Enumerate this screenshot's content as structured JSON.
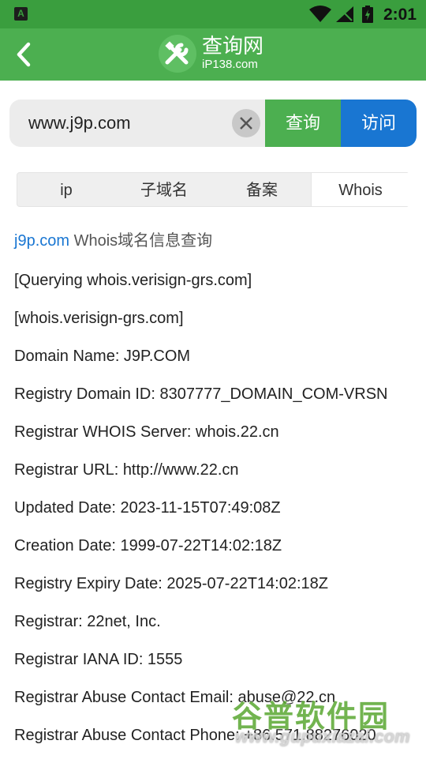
{
  "status_bar": {
    "time": "2:01",
    "app_letter": "A"
  },
  "app_bar": {
    "title": "查询网",
    "subtitle": "iP138.com"
  },
  "search": {
    "value": "www.j9p.com",
    "query_label": "查询",
    "visit_label": "访问"
  },
  "tabs": [
    {
      "label": "ip",
      "active": false
    },
    {
      "label": "子域名",
      "active": false
    },
    {
      "label": "备案",
      "active": false
    },
    {
      "label": "Whois",
      "active": true
    }
  ],
  "heading": {
    "domain": "j9p.com",
    "text": " Whois域名信息查询"
  },
  "whois_lines": [
    "[Querying whois.verisign-grs.com]",
    "[whois.verisign-grs.com]",
    "Domain Name: J9P.COM",
    "Registry Domain ID: 8307777_DOMAIN_COM-VRSN",
    "Registrar WHOIS Server: whois.22.cn",
    "Registrar URL: http://www.22.cn",
    "Updated Date: 2023-11-15T07:49:08Z",
    "Creation Date: 1999-07-22T14:02:18Z",
    "Registry Expiry Date: 2025-07-22T14:02:18Z",
    "Registrar: 22net, Inc.",
    "Registrar IANA ID: 1555",
    "Registrar Abuse Contact Email: abuse@22.cn",
    "Registrar Abuse Contact Phone: +86.571.88276020"
  ],
  "watermark": {
    "title": "谷普软件园",
    "url": "www.gupuxiazai.com"
  },
  "colors": {
    "status_bar": "#3a9e3e",
    "app_bar": "#4caf50",
    "query_button": "#4caf50",
    "visit_button": "#1976d2",
    "link": "#1976d2"
  }
}
